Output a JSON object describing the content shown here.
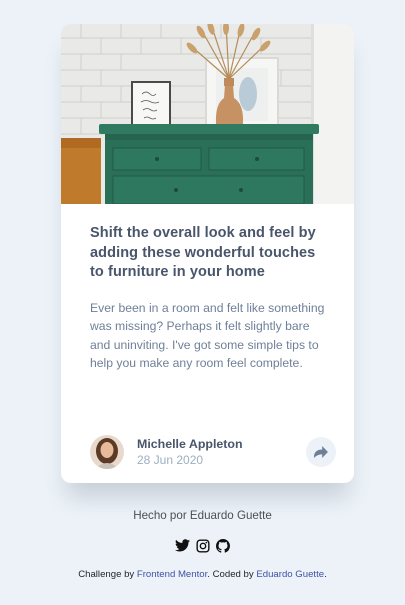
{
  "card": {
    "image_alt": "Green drawers with a framed print and a vase of dried grass",
    "title": "Shift the overall look and feel by adding these wonderful touches to furniture in your home",
    "description": "Ever been in a room and felt like something was missing? Perhaps it felt slightly bare and uninviting. I've got some simple tips to help you make any room feel complete.",
    "author": {
      "name": "Michelle Appleton",
      "date": "28 Jun 2020"
    },
    "share_icon": "share-arrow-icon"
  },
  "footer": {
    "made_by": "Hecho por Eduardo Guette",
    "social_icons": [
      "twitter-icon",
      "instagram-icon",
      "github-icon"
    ],
    "attribution": {
      "prefix": "Challenge by ",
      "frontend_mentor": "Frontend Mentor",
      "middle": ". Coded by ",
      "coder": "Eduardo Guette",
      "suffix": "."
    }
  },
  "colors": {
    "page_bg": "#ecf2f8",
    "title": "#48556a",
    "body_text": "#6e8098",
    "muted": "#9daec2",
    "link": "#3e52a3"
  }
}
